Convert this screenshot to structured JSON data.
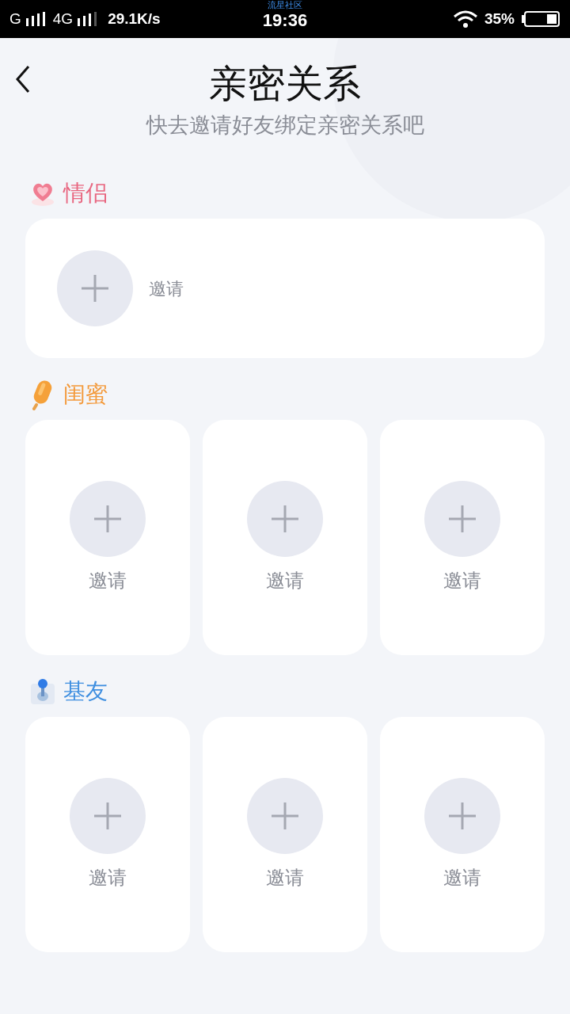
{
  "status_bar": {
    "network_1": "G",
    "network_2": "4G",
    "speed": "29.1K/s",
    "carrier_label": "流星社区",
    "time": "19:36",
    "battery": "35%"
  },
  "header": {
    "title": "亲密关系",
    "subtitle": "快去邀请好友绑定亲密关系吧"
  },
  "sections": [
    {
      "kind": "single",
      "title": "情侣",
      "color": "#e8657f",
      "slots": [
        {
          "label": "邀请"
        }
      ]
    },
    {
      "kind": "grid",
      "title": "闺蜜",
      "color": "#f39a3c",
      "slots": [
        {
          "label": "邀请"
        },
        {
          "label": "邀请"
        },
        {
          "label": "邀请"
        }
      ]
    },
    {
      "kind": "grid",
      "title": "基友",
      "color": "#3f8fe0",
      "slots": [
        {
          "label": "邀请"
        },
        {
          "label": "邀请"
        },
        {
          "label": "邀请"
        }
      ]
    }
  ]
}
